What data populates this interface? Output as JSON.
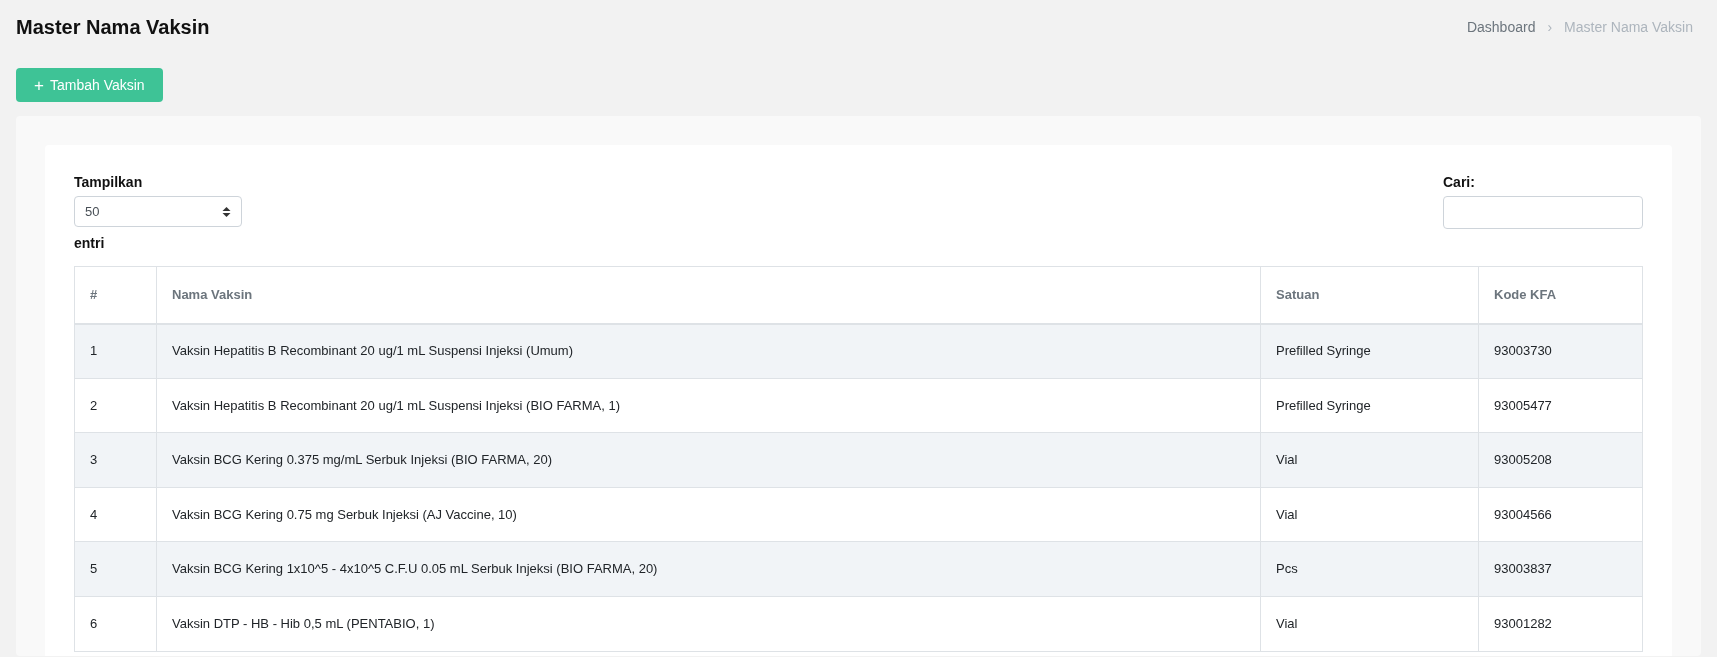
{
  "page_title": "Master Nama Vaksin",
  "breadcrumb": [
    {
      "label": "Dashboard",
      "selected": false
    },
    {
      "label": "Master Nama Vaksin",
      "selected": true
    }
  ],
  "breadcrumb_separator": "›",
  "add_button": {
    "icon": "+",
    "label": "Tambah Vaksin"
  },
  "length_control": {
    "label_before": "Tampilkan",
    "value": "50",
    "label_after": "entri"
  },
  "search": {
    "label": "Cari:"
  },
  "table": {
    "columns": [
      "#",
      "Nama Vaksin",
      "Satuan",
      "Kode KFA"
    ],
    "rows": [
      [
        "1",
        "Vaksin Hepatitis B Recombinant 20 ug/1 mL Suspensi Injeksi (Umum)",
        "Prefilled Syringe",
        "93003730"
      ],
      [
        "2",
        "Vaksin Hepatitis B Recombinant 20 ug/1 mL Suspensi Injeksi (BIO FARMA, 1)",
        "Prefilled Syringe",
        "93005477"
      ],
      [
        "3",
        "Vaksin BCG Kering 0.375 mg/mL Serbuk Injeksi (BIO FARMA, 20)",
        "Vial",
        "93005208"
      ],
      [
        "4",
        "Vaksin BCG Kering 0.75 mg Serbuk Injeksi (AJ Vaccine, 10)",
        "Vial",
        "93004566"
      ],
      [
        "5",
        "Vaksin BCG Kering 1x10^5 - 4x10^5 C.F.U 0.05 mL Serbuk Injeksi (BIO FARMA, 20)",
        "Pcs",
        "93003837"
      ],
      [
        "6",
        "Vaksin DTP - HB - Hib 0,5 mL (PENTABIO, 1)",
        "Vial",
        "93001282"
      ]
    ]
  }
}
